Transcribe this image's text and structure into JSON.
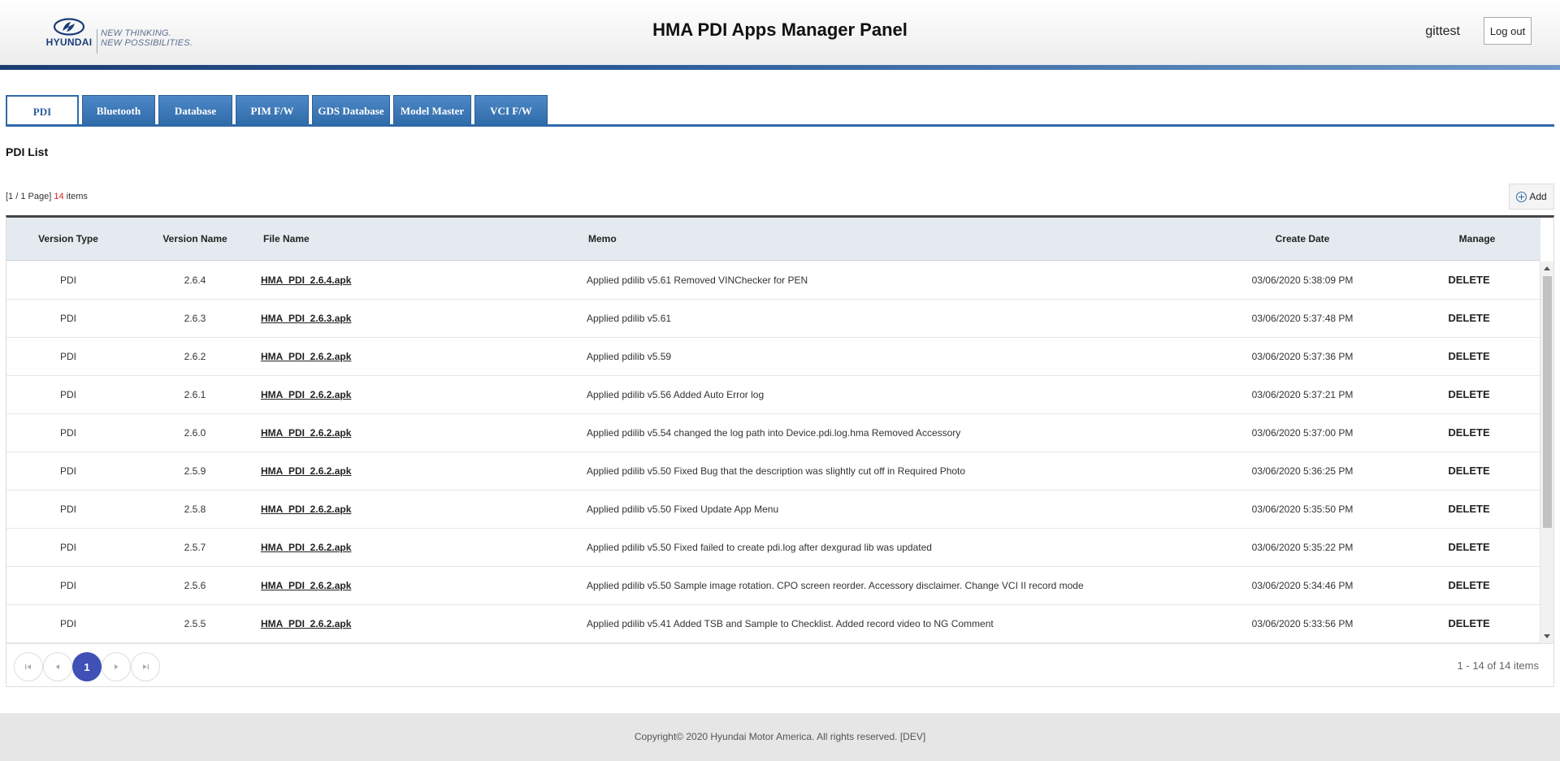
{
  "header": {
    "logo_brand": "HYUNDAI",
    "logo_tagline_1": "NEW THINKING.",
    "logo_tagline_2": "NEW POSSIBILITIES.",
    "title": "HMA PDI Apps Manager Panel",
    "username": "gittest",
    "logout_label": "Log out"
  },
  "tabs": [
    {
      "label": "PDI",
      "active": true
    },
    {
      "label": "Bluetooth",
      "active": false
    },
    {
      "label": "Database",
      "active": false
    },
    {
      "label": "PIM F/W",
      "active": false
    },
    {
      "label": "GDS Database",
      "active": false
    },
    {
      "label": "Model Master",
      "active": false
    },
    {
      "label": "VCI F/W",
      "active": false
    }
  ],
  "section_title": "PDI List",
  "paging": {
    "page_prefix": "[1 / 1 Page]",
    "count": "14",
    "suffix": "items"
  },
  "add_label": "Add",
  "grid": {
    "columns": {
      "version_type": "Version Type",
      "version_name": "Version Name",
      "file_name": "File Name",
      "memo": "Memo",
      "create_date": "Create Date",
      "manage": "Manage"
    },
    "rows": [
      {
        "type": "PDI",
        "version": "2.6.4",
        "file": "HMA_PDI_2.6.4.apk",
        "memo": "Applied pdilib v5.61 Removed VINChecker for PEN",
        "date": "03/06/2020 5:38:09 PM",
        "action": "DELETE"
      },
      {
        "type": "PDI",
        "version": "2.6.3",
        "file": "HMA_PDI_2.6.3.apk",
        "memo": "Applied pdilib v5.61",
        "date": "03/06/2020 5:37:48 PM",
        "action": "DELETE"
      },
      {
        "type": "PDI",
        "version": "2.6.2",
        "file": "HMA_PDI_2.6.2.apk",
        "memo": "Applied pdilib v5.59",
        "date": "03/06/2020 5:37:36 PM",
        "action": "DELETE"
      },
      {
        "type": "PDI",
        "version": "2.6.1",
        "file": "HMA_PDI_2.6.2.apk",
        "memo": "Applied pdilib v5.56 Added Auto Error log",
        "date": "03/06/2020 5:37:21 PM",
        "action": "DELETE"
      },
      {
        "type": "PDI",
        "version": "2.6.0",
        "file": "HMA_PDI_2.6.2.apk",
        "memo": "Applied pdilib v5.54 changed the log path into Device.pdi.log.hma Removed Accessory",
        "date": "03/06/2020 5:37:00 PM",
        "action": "DELETE"
      },
      {
        "type": "PDI",
        "version": "2.5.9",
        "file": "HMA_PDI_2.6.2.apk",
        "memo": "Applied pdilib v5.50 Fixed Bug that the description was slightly cut off in Required Photo",
        "date": "03/06/2020 5:36:25 PM",
        "action": "DELETE"
      },
      {
        "type": "PDI",
        "version": "2.5.8",
        "file": "HMA_PDI_2.6.2.apk",
        "memo": "Applied pdilib v5.50 Fixed Update App Menu",
        "date": "03/06/2020 5:35:50 PM",
        "action": "DELETE"
      },
      {
        "type": "PDI",
        "version": "2.5.7",
        "file": "HMA_PDI_2.6.2.apk",
        "memo": "Applied pdilib v5.50 Fixed failed to create pdi.log after dexgurad lib was updated",
        "date": "03/06/2020 5:35:22 PM",
        "action": "DELETE"
      },
      {
        "type": "PDI",
        "version": "2.5.6",
        "file": "HMA_PDI_2.6.2.apk",
        "memo": "Applied pdilib v5.50 Sample image rotation. CPO screen reorder. Accessory disclaimer. Change VCI II record mode",
        "date": "03/06/2020 5:34:46 PM",
        "action": "DELETE"
      },
      {
        "type": "PDI",
        "version": "2.5.5",
        "file": "HMA_PDI_2.6.2.apk",
        "memo": "Applied pdilib v5.41 Added TSB and Sample to Checklist. Added record video to NG Comment",
        "date": "03/06/2020 5:33:56 PM",
        "action": "DELETE"
      }
    ]
  },
  "pager": {
    "current_page": "1",
    "info": "1 - 14 of 14 items",
    "first_icon": "first-page-icon",
    "prev_icon": "prev-page-icon",
    "next_icon": "next-page-icon",
    "last_icon": "last-page-icon"
  },
  "footer": "Copyright© 2020 Hyundai Motor America. All rights reserved. [DEV]",
  "colors": {
    "accent": "#2f6aa9",
    "pager_current": "#3f51b5",
    "count_highlight": "#d9261c"
  }
}
